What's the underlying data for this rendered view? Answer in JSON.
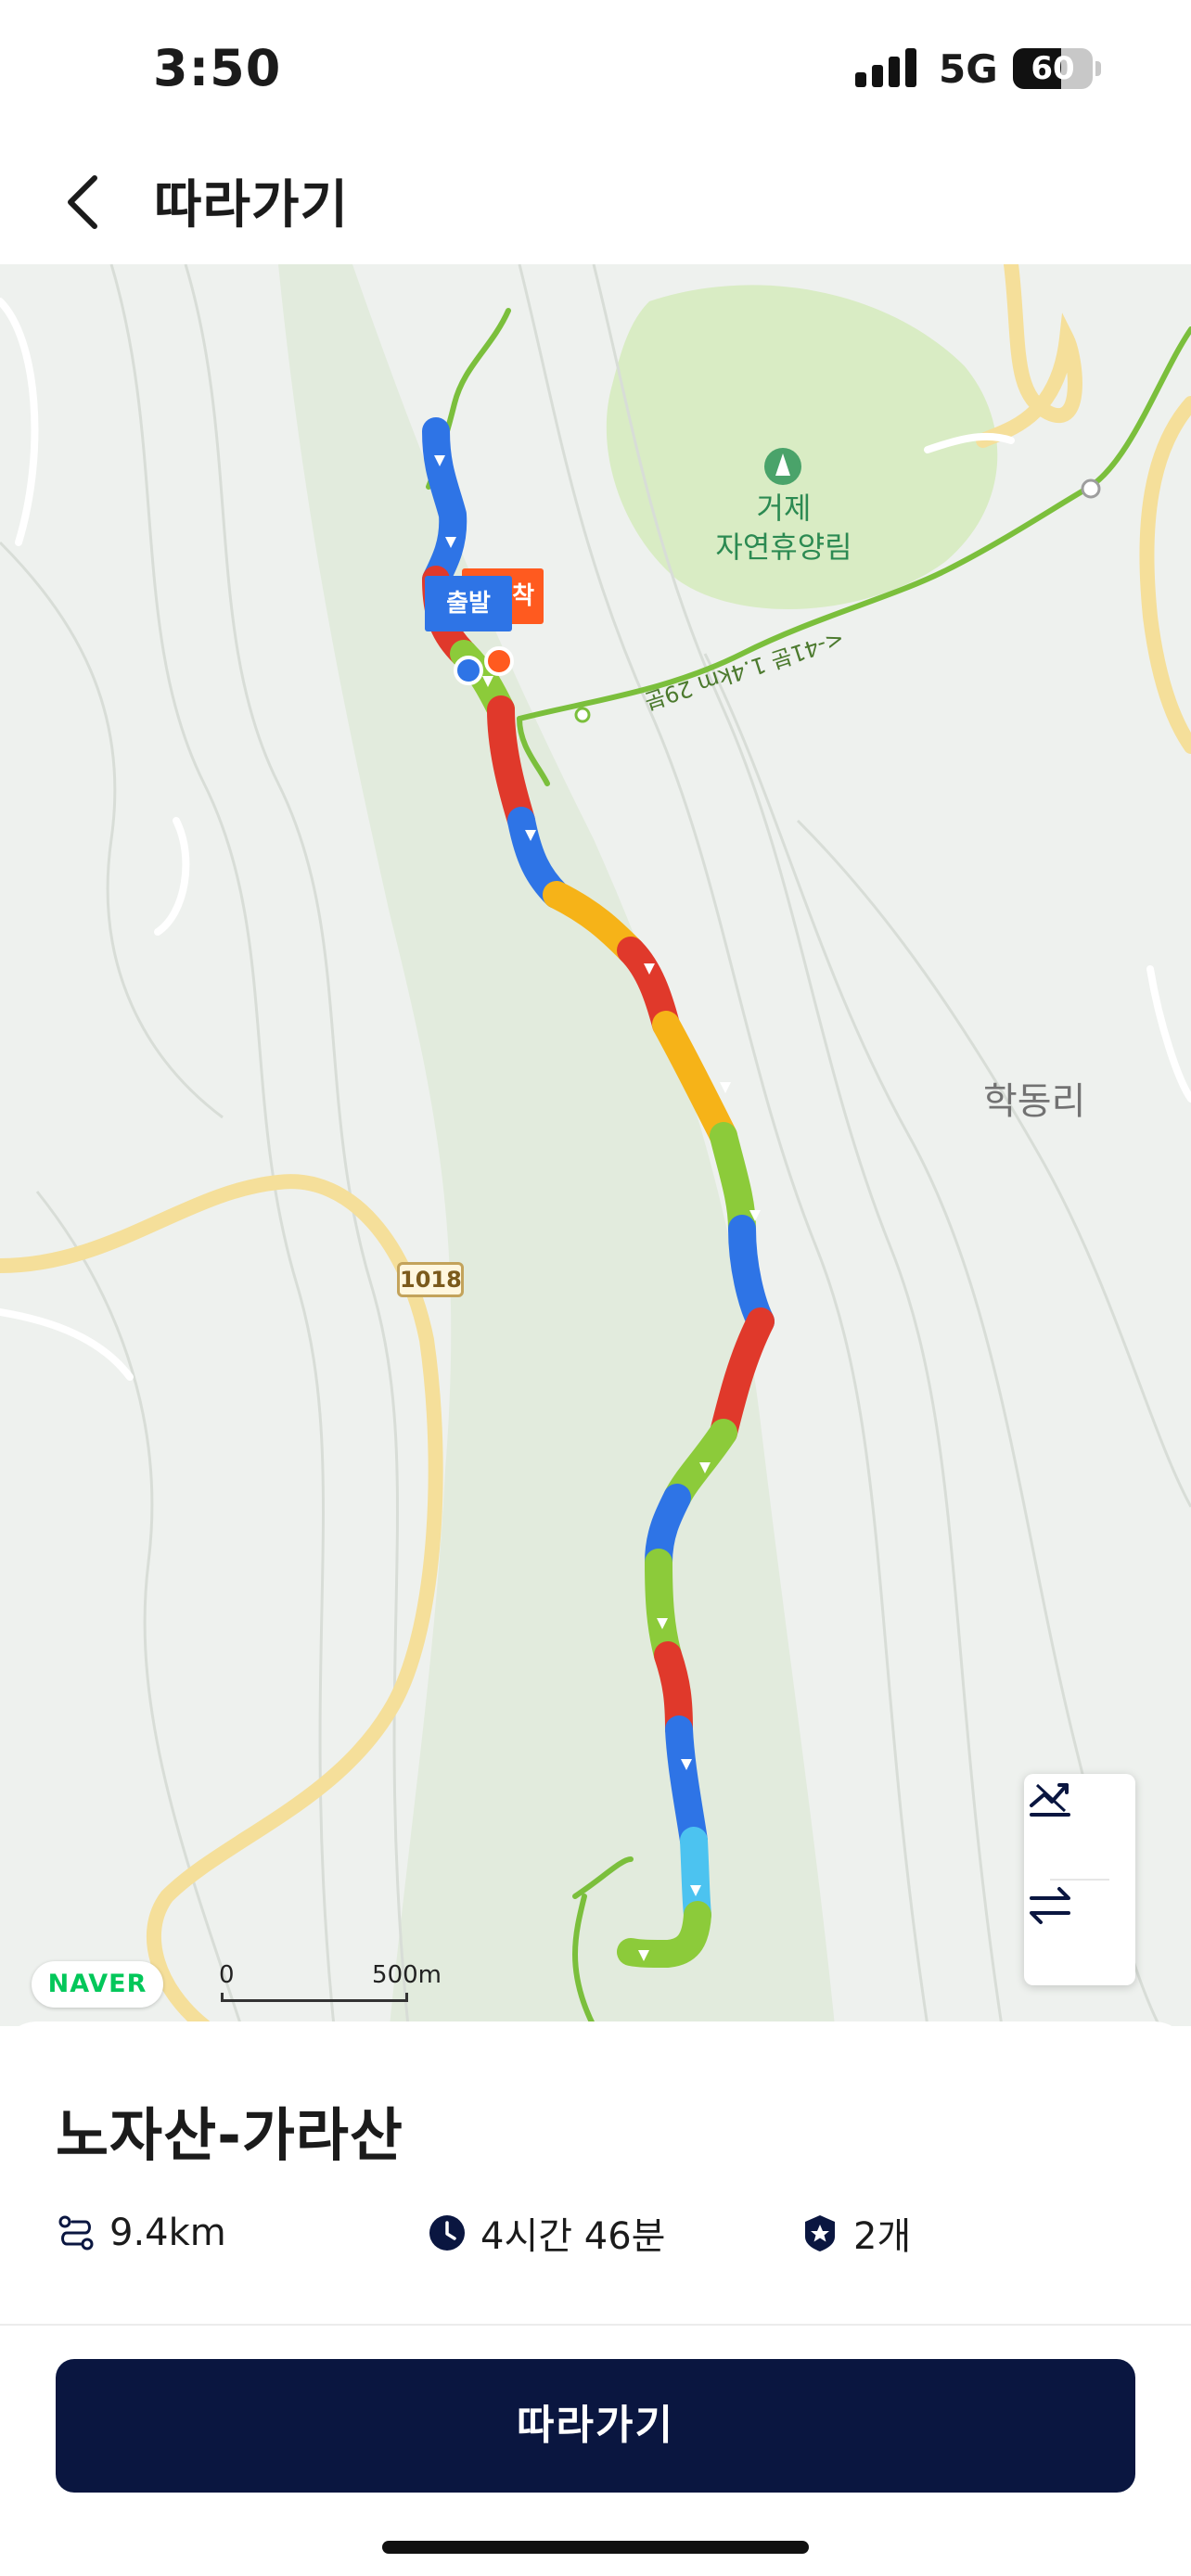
{
  "status_bar": {
    "time": "3:50",
    "network": "5G",
    "battery": "60",
    "battery_level": 0.6
  },
  "header": {
    "title": "따라가기",
    "back_icon": "chevron-left-icon"
  },
  "map": {
    "forest_label": "거제\n자연휴양림",
    "village_label": "학동리",
    "trail_label": "<-41분 1.4km 29분",
    "road_number": "1018",
    "start_label": "출발",
    "end_label": "도착",
    "logo": "NAVER",
    "scale_zero": "0",
    "scale_distance": "500m",
    "controls": [
      {
        "icon": "elevation-profile-icon"
      },
      {
        "icon": "reverse-direction-icon"
      }
    ]
  },
  "route": {
    "title": "노자산-가라산",
    "distance": "9.4km",
    "duration": "4시간 46분",
    "badge_count": "2개",
    "distance_icon": "route-distance-icon",
    "duration_icon": "clock-icon",
    "badge_icon": "badge-star-icon"
  },
  "actions": {
    "follow_label": "따라가기"
  },
  "colors": {
    "primary": "#0a1640",
    "start": "#2e74e6",
    "end": "#ff5a1f",
    "naver": "#03c75a",
    "track_palette": [
      "#2e74e6",
      "#4cc3f0",
      "#8ccb3a",
      "#f6b318",
      "#e0392b"
    ]
  }
}
